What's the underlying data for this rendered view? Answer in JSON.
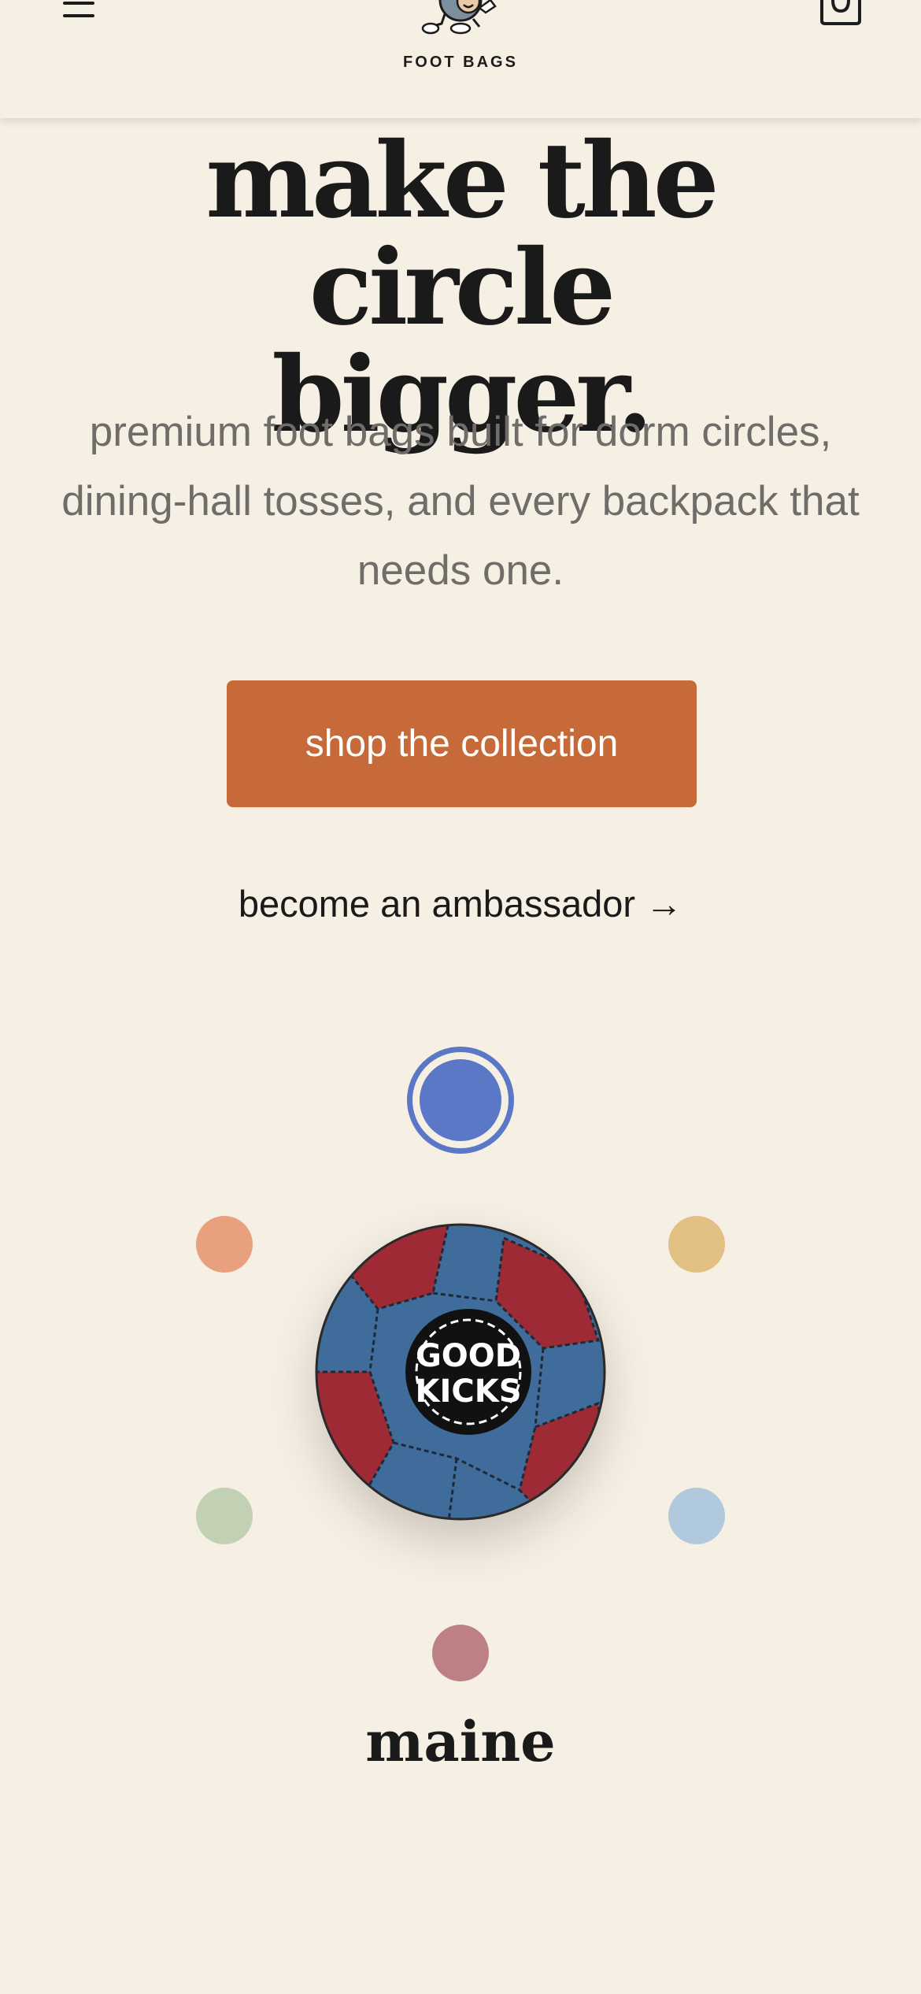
{
  "header": {
    "logo_text": "FOOT BAGS",
    "menu_icon": "hamburger-menu-icon",
    "cart_icon": "shopping-bag-icon"
  },
  "hero": {
    "headline_line1": "make the circle",
    "headline_line2": "bigger.",
    "subtext": "premium foot bags built for dorm circles, dining-hall tosses, and every backpack that needs one.",
    "cta_label": "shop the collection",
    "secondary_link": "become an ambassador →"
  },
  "product": {
    "badge_line1": "GOOD",
    "badge_line2": "KICKS",
    "selected_color_name": "maine",
    "colors": {
      "selected": "#5b78c6",
      "peach": "#e8a07f",
      "mustard": "#e2c083",
      "sage": "#c2d0b3",
      "skyblue": "#b0c9dd",
      "rose": "#bd8185",
      "ball_blue": "#3f6c9a",
      "ball_red": "#9e2a35"
    }
  },
  "theme": {
    "background": "#f6efe4",
    "accent": "#c76a3a",
    "text": "#1a1a1a",
    "muted": "#6f6d69"
  }
}
